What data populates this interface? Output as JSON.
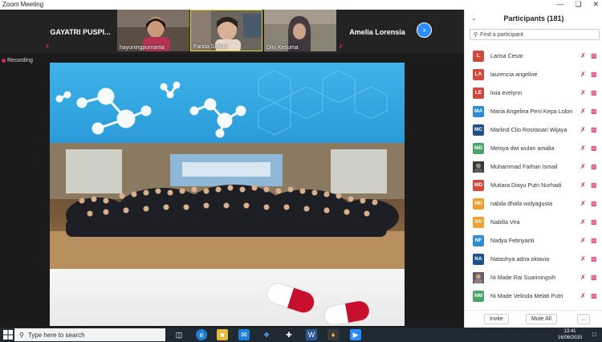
{
  "window": {
    "title": "Zoom Meeting"
  },
  "strip": {
    "name_tiles": [
      "GAYATRI PUSPI...",
      "Amelia Lorensia"
    ],
    "video_tiles": [
      "hayuningpurnama",
      "Farida Suhud",
      "Dini Kesuma"
    ]
  },
  "recording": {
    "label": "Recording"
  },
  "panel": {
    "title": "Participants (181)",
    "search_placeholder": "Find a participant",
    "participants": [
      {
        "initials": "L",
        "name": "Larisa Cesar",
        "color": "#d2483d"
      },
      {
        "initials": "LA",
        "name": "laurencia angeline",
        "color": "#d2483d"
      },
      {
        "initials": "LE",
        "name": "livia evelynn",
        "color": "#d2483d"
      },
      {
        "initials": "MA",
        "name": "Maria Angelina Peni Kepa Lolon",
        "color": "#2d8cd8"
      },
      {
        "initials": "MC",
        "name": "Marlind Clio Rositasari Wijaya",
        "color": "#1f4e8c"
      },
      {
        "initials": "MD",
        "name": "Meisya dwi wulan amalia",
        "color": "#48a567"
      },
      {
        "initials": "",
        "name": "Muhammad Farhan Ismail",
        "color": "#222222"
      },
      {
        "initials": "MD",
        "name": "Mutiara Diayu Putri Nurhadi",
        "color": "#d2483d"
      },
      {
        "initials": "ND",
        "name": "nabila dhafa widyagusta",
        "color": "#f0a030"
      },
      {
        "initials": "NV",
        "name": "Nabilla Vira",
        "color": "#f0a030"
      },
      {
        "initials": "NF",
        "name": "Nadya Febriyanti",
        "color": "#2d8cd8"
      },
      {
        "initials": "NA",
        "name": "Natashya adna oktavia",
        "color": "#1f4e8c"
      },
      {
        "initials": "",
        "name": "Ni Made Rai Suariningsih",
        "color": "#555555"
      },
      {
        "initials": "NM",
        "name": "Ni Made Velinda Melati Putri",
        "color": "#48a567"
      }
    ],
    "invite_label": "Invite",
    "mute_all_label": "Mute All",
    "more_label": "..."
  },
  "taskbar": {
    "search_placeholder": "Type here to search",
    "time": "13:41",
    "date": "16/06/2020"
  }
}
